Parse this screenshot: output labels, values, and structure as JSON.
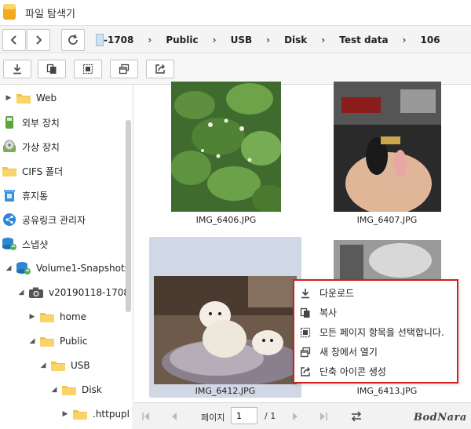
{
  "window": {
    "title": "파일 탐색기"
  },
  "pathbar": {
    "crumbs": [
      "-1708",
      "Public",
      "USB",
      "Disk",
      "Test data",
      "106"
    ]
  },
  "sidebar": {
    "items": [
      {
        "label": "Web",
        "icon": "folder-icon"
      },
      {
        "label": "외부 장치",
        "icon": "usb-icon"
      },
      {
        "label": "가상 장치",
        "icon": "disc-icon"
      },
      {
        "label": "CIFS 폴더",
        "icon": "folder-icon"
      },
      {
        "label": "휴지통",
        "icon": "trash-icon"
      },
      {
        "label": "공유링크 관리자",
        "icon": "share-icon"
      },
      {
        "label": "스냅샷",
        "icon": "snapshot-icon"
      },
      {
        "label": "Volume1-Snapshots",
        "icon": "snapshot-icon"
      },
      {
        "label": "v20190118-1708",
        "icon": "camera-icon"
      },
      {
        "label": "home",
        "icon": "folder-icon"
      },
      {
        "label": "Public",
        "icon": "folder-icon"
      },
      {
        "label": "USB",
        "icon": "folder-icon"
      },
      {
        "label": "Disk",
        "icon": "folder-icon"
      },
      {
        "label": ".httpupl",
        "icon": "folder-icon"
      }
    ]
  },
  "files": [
    {
      "name": "IMG_6406.JPG"
    },
    {
      "name": "IMG_6407.JPG"
    },
    {
      "name": "IMG_6412.JPG"
    },
    {
      "name": "IMG_6413.JPG"
    }
  ],
  "context_menu": {
    "items": [
      {
        "label": "다운로드",
        "icon": "download-icon"
      },
      {
        "label": "복사",
        "icon": "copy-icon"
      },
      {
        "label": "모든 페이지 항목을 선택합니다.",
        "icon": "select-all-icon"
      },
      {
        "label": "새 창에서 열기",
        "icon": "new-window-icon"
      },
      {
        "label": "단축 아이콘 생성",
        "icon": "shortcut-icon"
      }
    ]
  },
  "pager": {
    "page_label": "페이지",
    "current_page": "1",
    "total": "/ 1"
  },
  "watermark": "BodNara",
  "colors": {
    "accent_highlight": "#d21f1f",
    "selection": "#cfd8e4",
    "folder": "#f5c242"
  }
}
